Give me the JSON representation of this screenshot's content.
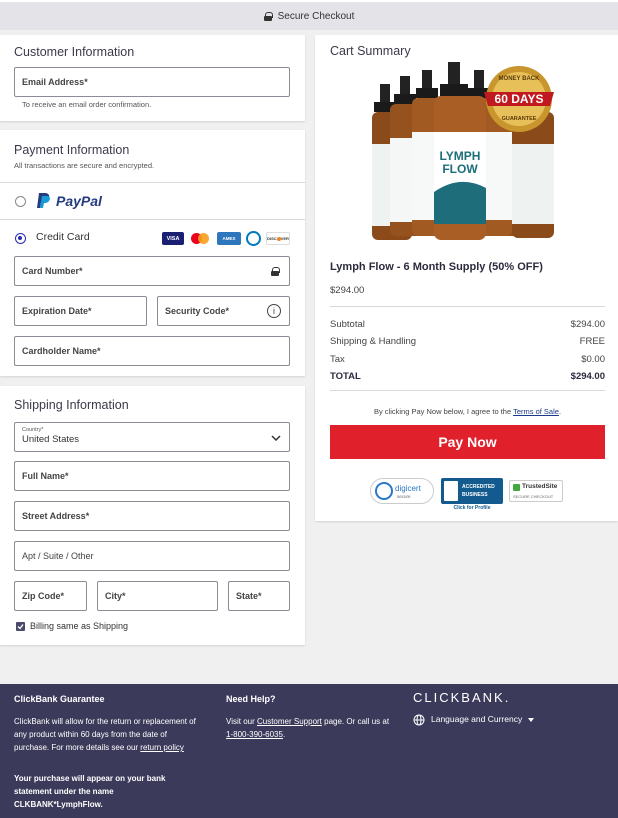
{
  "topbar": {
    "label": "Secure Checkout"
  },
  "customer": {
    "title": "Customer Information",
    "email_label": "Email Address*",
    "email_hint": "To receive an email order confirmation."
  },
  "payment": {
    "title": "Payment Information",
    "subtitle": "All transactions are secure and encrypted.",
    "paypal_label": "PayPal",
    "credit_label": "Credit Card",
    "card_number": "Card Number*",
    "expiration": "Expiration Date*",
    "security_code": "Security Code*",
    "cardholder": "Cardholder Name*",
    "card_brands": [
      "VISA",
      "MC",
      "AMEX",
      "DINERS",
      "DISCOVER"
    ]
  },
  "shipping": {
    "title": "Shipping Information",
    "country_label": "Country*",
    "country_value": "United States",
    "full_name": "Full Name*",
    "street": "Street Address*",
    "apt": "Apt / Suite / Other",
    "zip": "Zip Code*",
    "city": "City*",
    "state": "State*",
    "billing_same": "Billing same as Shipping"
  },
  "cart": {
    "title": "Cart Summary",
    "product_name": "Lymph Flow - 6 Month Supply (50% OFF)",
    "product_price": "$294.00",
    "badge_top": "MONEY BACK",
    "badge_days": "60 DAYS",
    "badge_bottom": "GUARANTEE",
    "bottle_text_1": "LYMPH",
    "bottle_text_2": "FLOW",
    "lines": [
      {
        "label": "Subtotal",
        "value": "$294.00"
      },
      {
        "label": "Shipping & Handling",
        "value": "FREE"
      },
      {
        "label": "Tax",
        "value": "$0.00"
      },
      {
        "label": "TOTAL",
        "value": "$294.00"
      }
    ],
    "terms_prefix": "By clicking Pay Now below, I agree to the ",
    "terms_link": "Terms of Sale",
    "terms_suffix": ".",
    "pay_button": "Pay Now",
    "trust": {
      "digicert": "digicert",
      "digicert_sub": "secure",
      "bbb_line1": "ACCREDITED",
      "bbb_line2": "BUSINESS",
      "bbb_click": "Click for Profile",
      "trusted": "TrustedSite",
      "trusted_sub": "SECURE CHECKOUT"
    }
  },
  "footer": {
    "guarantee_title": "ClickBank Guarantee",
    "guarantee_text": "ClickBank will allow for the return or replacement of any product within 60 days from the date of purchase. For more details see our",
    "return_link": "return policy",
    "statement_text": "Your purchase will appear on your bank statement under the name CLKBANK*LymphFlow.",
    "help_title": "Need Help?",
    "help_prefix": "Visit our ",
    "support_link": "Customer Support",
    "help_mid": " page. Or call us at ",
    "phone": "1-800-390-6035",
    "help_suffix": ".",
    "brand": "CLICKBANK.",
    "language": "Language and Currency"
  },
  "colors": {
    "accent": "#2a2cb0",
    "pay_button": "#e0202a",
    "footer_bg": "#3c3a5a",
    "paypal_dark": "#253b80",
    "paypal_light": "#179bd7"
  }
}
